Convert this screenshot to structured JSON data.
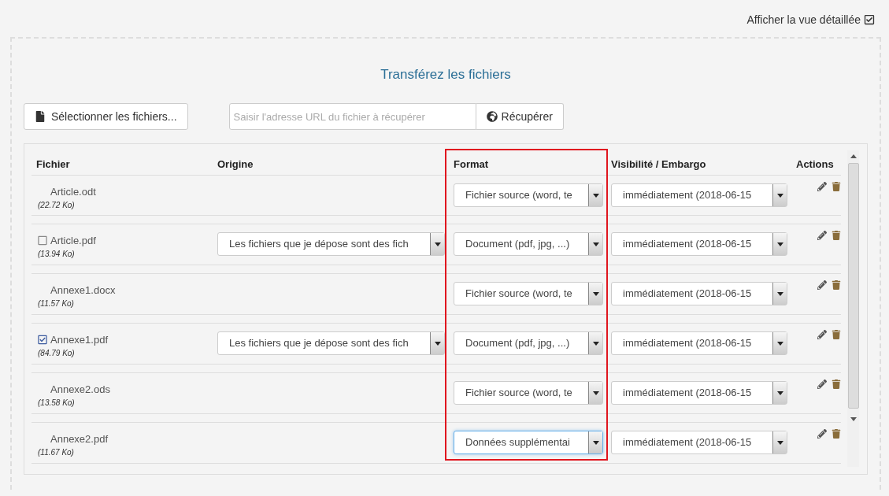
{
  "detail_toggle": {
    "label": "Afficher la vue détaillée",
    "checked": true
  },
  "title": "Transférez les fichiers",
  "select_button": "Sélectionner les fichiers...",
  "url_field": {
    "placeholder": "Saisir l'adresse URL du fichier à récupérer"
  },
  "fetch_button": "Récupérer",
  "columns": [
    {
      "label": "Fichier",
      "highlighted": false
    },
    {
      "label": "Origine",
      "highlighted": false
    },
    {
      "label": "Format",
      "highlighted": true
    },
    {
      "label": "Visibilité / Embargo",
      "highlighted": false
    },
    {
      "label": "Actions",
      "highlighted": false
    }
  ],
  "rows": [
    {
      "name": "Article.odt",
      "size": "(22.72 Ko)",
      "format": "Fichier source (word, te",
      "visibility": "immédiatement (2018-06-15",
      "format_focused": false
    },
    {
      "name": "Article.pdf",
      "size": "(13.94 Ko)",
      "checked": false,
      "origin": "Les fichiers que je dépose sont des fich",
      "format": "Document (pdf, jpg, ...)",
      "visibility": "immédiatement (2018-06-15",
      "format_focused": false
    },
    {
      "name": "Annexe1.docx",
      "size": "(11.57 Ko)",
      "format": "Fichier source (word, te",
      "visibility": "immédiatement (2018-06-15",
      "format_focused": false
    },
    {
      "name": "Annexe1.pdf",
      "size": "(84.79 Ko)",
      "checked": true,
      "origin": "Les fichiers que je dépose sont des fich",
      "format": "Document (pdf, jpg, ...)",
      "visibility": "immédiatement (2018-06-15",
      "format_focused": false
    },
    {
      "name": "Annexe2.ods",
      "size": "(13.58 Ko)",
      "format": "Fichier source (word, te",
      "visibility": "immédiatement (2018-06-15",
      "format_focused": false
    },
    {
      "name": "Annexe2.pdf",
      "size": "(11.67 Ko)",
      "format": "Données supplémentai",
      "visibility": "immédiatement (2018-06-15",
      "format_focused": true
    }
  ]
}
